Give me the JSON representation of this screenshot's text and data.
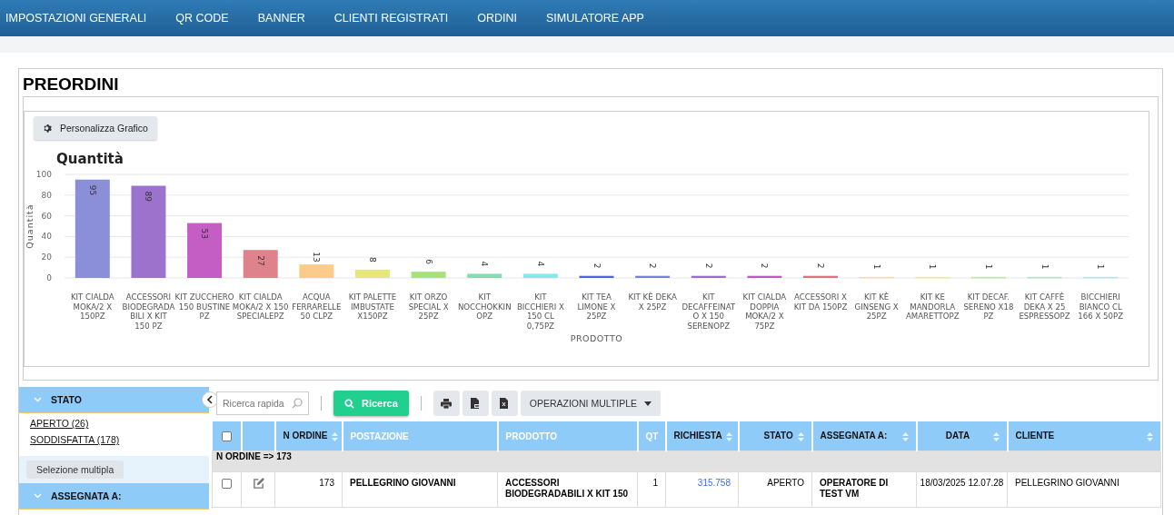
{
  "nav": {
    "items": [
      {
        "label": "IMPOSTAZIONI GENERALI"
      },
      {
        "label": "QR CODE"
      },
      {
        "label": "BANNER"
      },
      {
        "label": "CLIENTI REGISTRATI"
      },
      {
        "label": "ORDINI"
      },
      {
        "label": "SIMULATORE APP"
      }
    ]
  },
  "page": {
    "title": "PREORDINI"
  },
  "chart": {
    "customize_button": "Personalizza Grafico",
    "chart_data": {
      "type": "bar",
      "grid": true,
      "title": "Quantità",
      "xlabel": "PRODOTTO",
      "ylabel": "Quantità",
      "ylim": [
        0,
        100
      ],
      "yticks": [
        0,
        20,
        40,
        60,
        80,
        100
      ],
      "data_labels": true,
      "categories": [
        "KIT CIALDA MOKA/2 X 150PZ",
        "ACCESSORI BIODEGRADA BILI X KIT 150 PZ",
        "KIT ZUCCHERO 150 BUSTINE PZ",
        "KIT CIALDA MOKA/2 X 150 SPECIALEPZ",
        "ACQUA FERRARELLE 50 CLPZ",
        "KIT PALETTE IMBUSTATE X150PZ",
        "KIT ORZO SPECIAL X 25PZ",
        "KIT NOCCHOKKIN OPZ",
        "KIT BICCHIERI X 150 CL 0,75PZ",
        "KIT TEA LIMONE X 25PZ",
        "KIT KÈ DEKA X 25PZ",
        "KIT DECAFFEINAT O X 150 SERENOPZ",
        "KIT CIALDA DOPPIA MOKA/2 X 75PZ",
        "ACCESSORI X KIT DA 150PZ",
        "KIT KÈ GINSENG X 25PZ",
        "KIT KE MANDORLA AMARETTOPZ",
        "KIT DECAF. SERENO X18 PZ",
        "KIT CAFFÈ DEKA X 25 ESPRESSOPZ",
        "BICCHIERI BIANCO CL 166 X 50PZ"
      ],
      "series": [
        {
          "values": [
            95,
            89,
            53,
            27,
            13,
            8,
            6,
            4,
            4,
            2,
            2,
            2,
            2,
            2,
            1,
            1,
            1,
            1,
            1
          ],
          "colors": [
            "#8a8fd8",
            "#9b73cc",
            "#c45ec4",
            "#e0828c",
            "#fccb8a",
            "#e6e67a",
            "#a8e07a",
            "#82dcb4",
            "#87e8ec",
            "#5060e8",
            "#7a7ee0",
            "#9a6ad8",
            "#c058c8",
            "#e07080",
            "#fcd8a0",
            "#ecec90",
            "#b8e890",
            "#a0e8c8",
            "#a0ecf0"
          ]
        }
      ]
    }
  },
  "sidebar": {
    "sections": [
      {
        "title": "STATO",
        "expanded": true,
        "items": [
          {
            "label": "APERTO (26)"
          },
          {
            "label": "SODDISFATTA (178)"
          }
        ],
        "button": "Selezione multipla"
      },
      {
        "title": "ASSEGNATA A:",
        "expanded": true
      }
    ]
  },
  "toolbar": {
    "search": {
      "placeholder": "Ricerca rapida"
    },
    "search_button": "Ricerca",
    "multi_button": "OPERAZIONI MULTIPLE"
  },
  "table": {
    "select_all_checked": false,
    "columns": [
      {
        "kind": "checkbox"
      },
      {
        "kind": "edit"
      },
      {
        "label": "N ORDINE",
        "sortable": true
      },
      {
        "label": "POSTAZIONE",
        "sortable": false
      },
      {
        "label": "PRODOTTO",
        "sortable": false
      },
      {
        "label": "QT",
        "sortable": false
      },
      {
        "label": "RICHIESTA",
        "sortable": true
      },
      {
        "label": "STATO",
        "sortable": true
      },
      {
        "label": "ASSEGNATA A:",
        "sortable": true
      },
      {
        "label": "DATA",
        "sortable": true
      },
      {
        "label": "CLIENTE",
        "sortable": true
      }
    ],
    "group": "N ORDINE => 173",
    "rows": [
      {
        "checked": false,
        "order": "173",
        "postazione": "PELLEGRINO GIOVANNI",
        "prodotto": "ACCESSORI BIODEGRADABILI X KIT 150",
        "qt": "1",
        "richiesta": "315.758",
        "stato": "APERTO",
        "assegnata": "OPERATORE DI TEST VM",
        "data": "18/03/2025 12.07.28",
        "cliente": "PELLEGRINO GIOVANNI"
      }
    ]
  }
}
